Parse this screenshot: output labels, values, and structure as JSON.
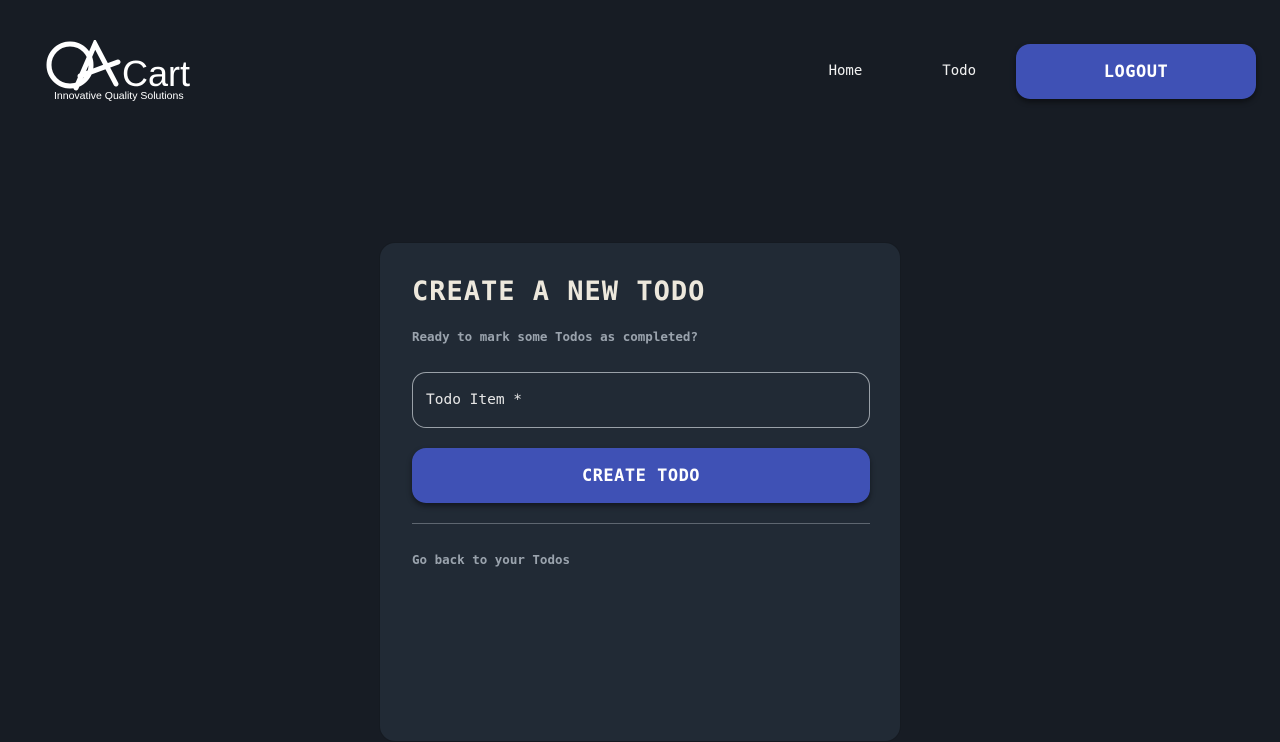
{
  "brand": {
    "logo_text": "QACart",
    "tagline": "Innovative Quality Solutions"
  },
  "nav": {
    "items": [
      {
        "label": "Home"
      },
      {
        "label": "Todo"
      }
    ],
    "logout_label": "LOGOUT"
  },
  "card": {
    "title": "CREATE A NEW TODO",
    "subtitle": "Ready to mark some Todos as completed?",
    "input": {
      "label": "Todo Item *",
      "value": ""
    },
    "submit_label": "CREATE TODO",
    "back_link": "Go back to your Todos"
  },
  "colors": {
    "background": "#171c24",
    "card": "#212a35",
    "accent": "#3f51b5"
  }
}
